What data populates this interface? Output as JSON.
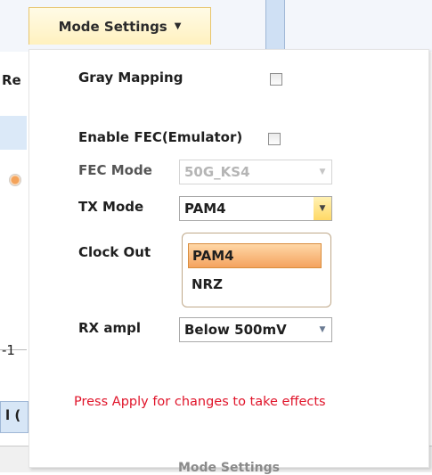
{
  "header": {
    "mode_tab_label": "Mode Settings"
  },
  "background": {
    "left_text_1": "Re",
    "left_text_2": "-1",
    "left_text_3": "l ("
  },
  "panel": {
    "gray_mapping": {
      "label": "Gray Mapping",
      "checked": false
    },
    "enable_fec": {
      "label": "Enable FEC(Emulator)",
      "checked": false
    },
    "fec_mode": {
      "label": "FEC Mode",
      "value": "50G_KS4"
    },
    "tx_mode": {
      "label": "TX Mode",
      "value": "PAM4",
      "options": [
        "PAM4",
        "NRZ"
      ],
      "highlighted": "PAM4"
    },
    "clock_out": {
      "label": "Clock Out"
    },
    "rx_ampl": {
      "label": "RX ampl",
      "value": "Below 500mV"
    },
    "notice": "Press Apply for changes to take effects",
    "footer": "Mode Settings"
  },
  "colors": {
    "notice": "#e0142a",
    "selection": "#f4a35f",
    "tab_gold": "#fff1bf"
  }
}
